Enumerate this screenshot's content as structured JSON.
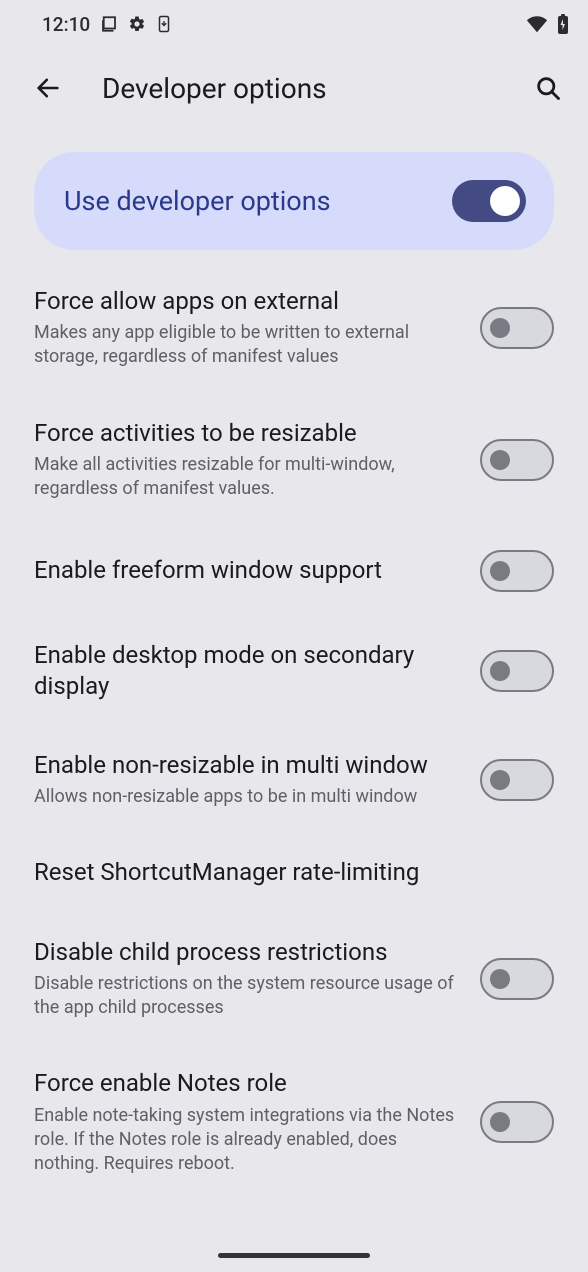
{
  "status": {
    "time": "12:10"
  },
  "header": {
    "title": "Developer options"
  },
  "master": {
    "label": "Use developer options",
    "on": true
  },
  "settings": [
    {
      "title": "Force allow apps on external",
      "subtitle": "Makes any app eligible to be written to external storage, regardless of manifest values",
      "toggle": true,
      "on": false
    },
    {
      "title": "Force activities to be resizable",
      "subtitle": "Make all activities resizable for multi-window, regardless of manifest values.",
      "toggle": true,
      "on": false
    },
    {
      "title": "Enable freeform window support",
      "subtitle": "",
      "toggle": true,
      "on": false
    },
    {
      "title": "Enable desktop mode on secondary display",
      "subtitle": "",
      "toggle": true,
      "on": false
    },
    {
      "title": "Enable non-resizable in multi window",
      "subtitle": "Allows non-resizable apps to be in multi window",
      "toggle": true,
      "on": false
    },
    {
      "title": "Reset ShortcutManager rate-limiting",
      "subtitle": "",
      "toggle": false,
      "on": false
    },
    {
      "title": "Disable child process restrictions",
      "subtitle": "Disable restrictions on the system resource usage of the app child processes",
      "toggle": true,
      "on": false
    },
    {
      "title": "Force enable Notes role",
      "subtitle": "Enable note-taking system integrations via the Notes role. If the Notes role is already enabled, does nothing. Requires reboot.",
      "toggle": true,
      "on": false
    }
  ]
}
